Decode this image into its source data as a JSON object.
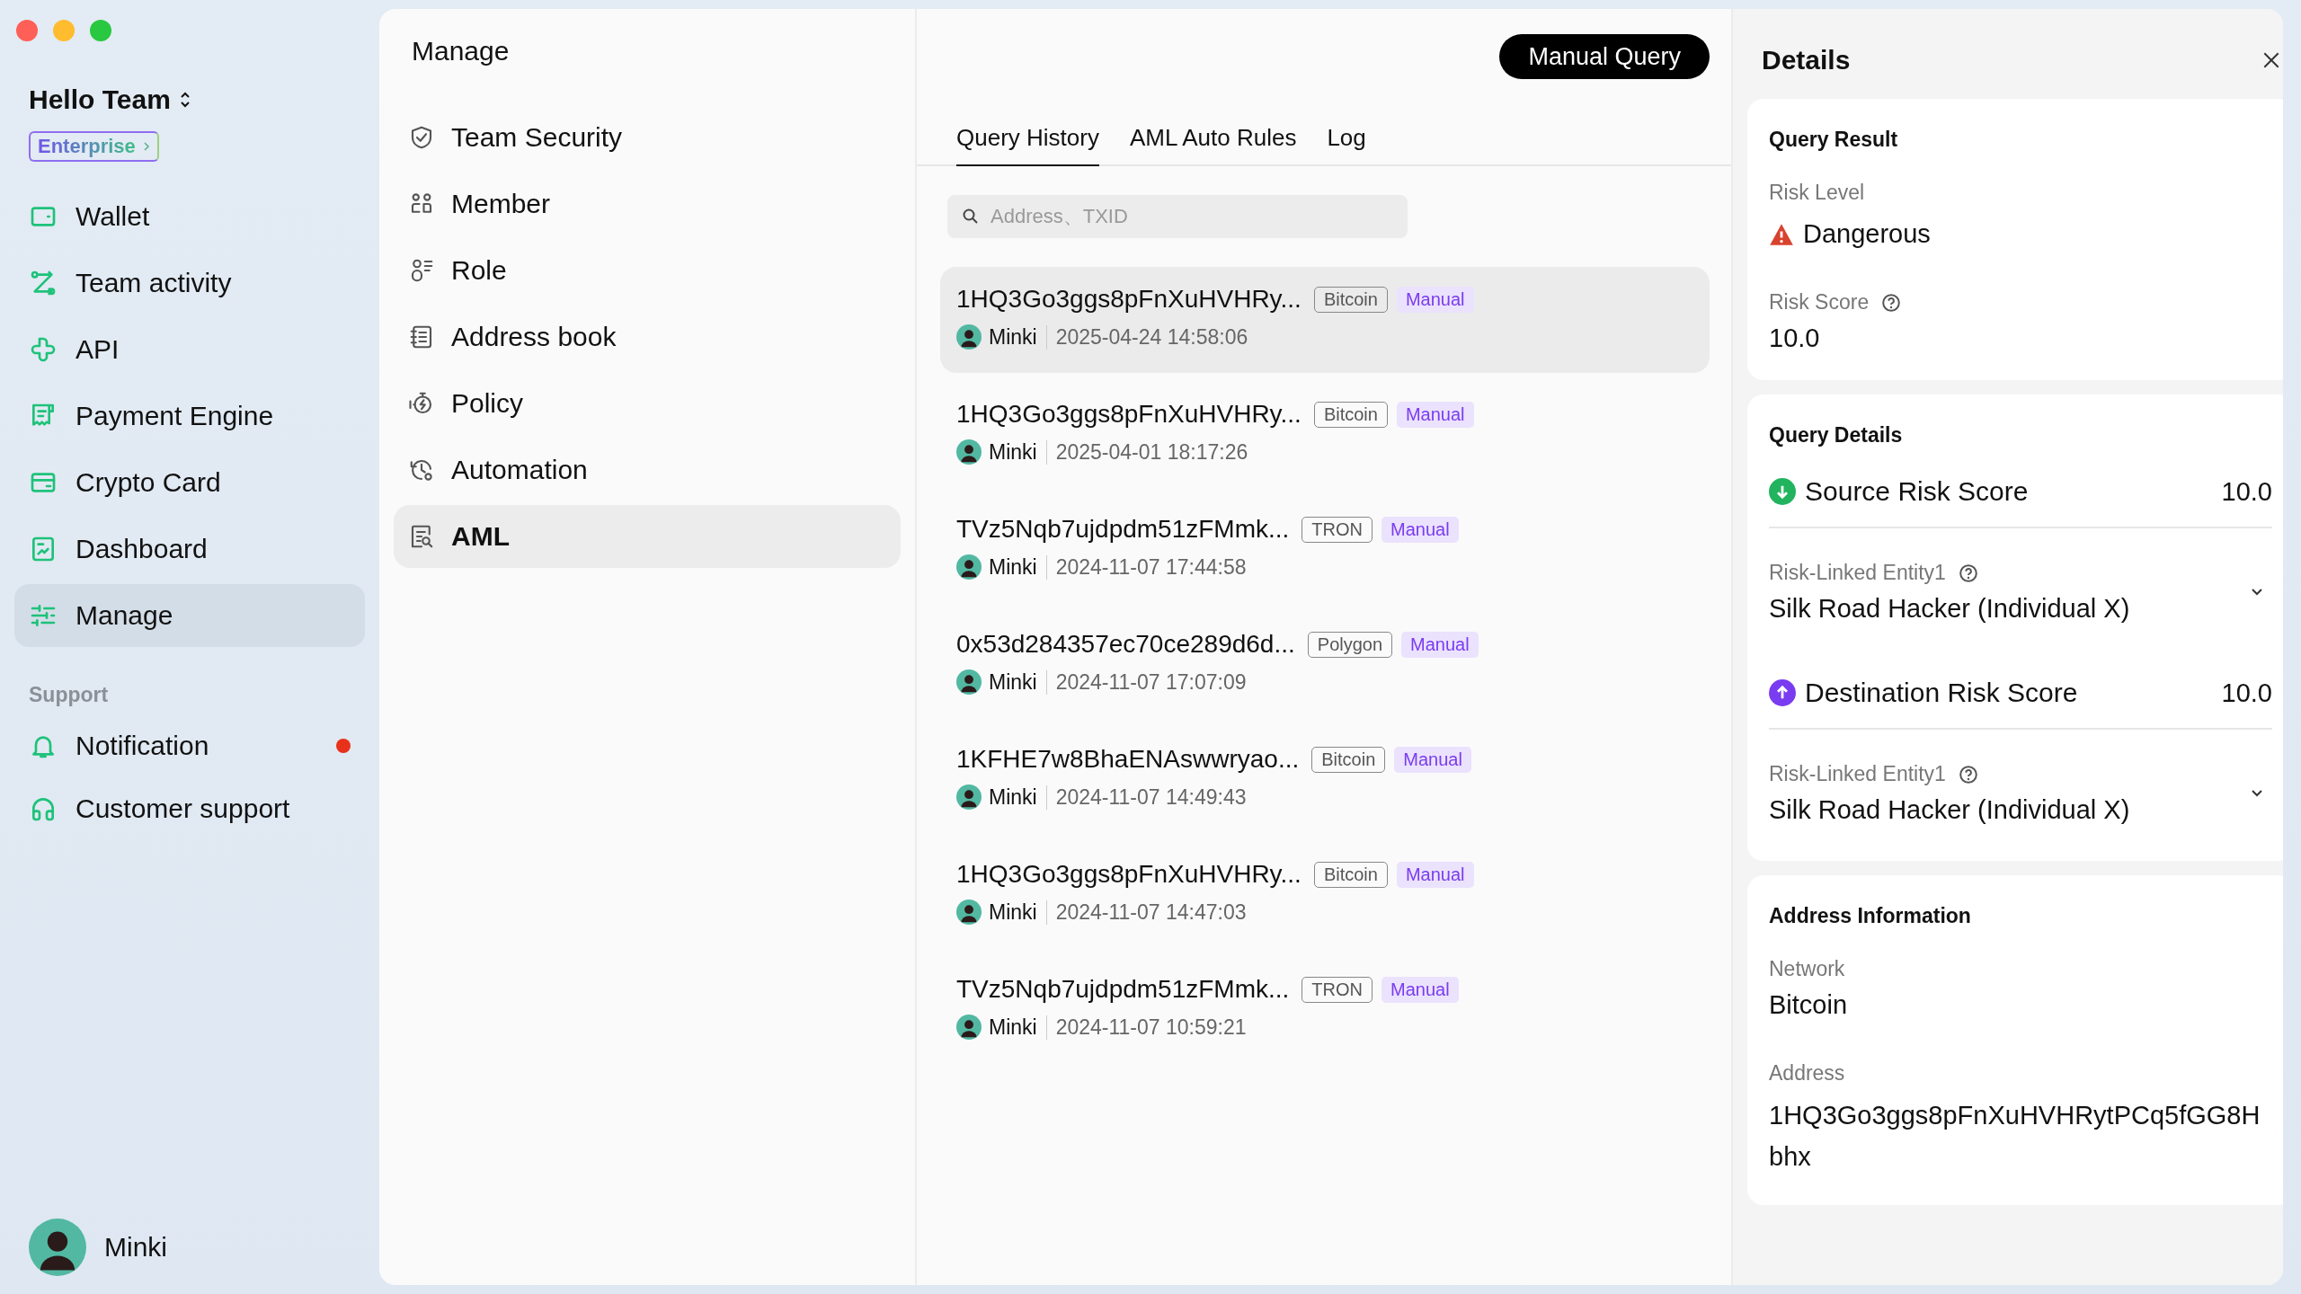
{
  "sidebar": {
    "team_name": "Hello Team",
    "plan_badge": "Enterprise",
    "nav": [
      {
        "label": "Wallet",
        "selected": false
      },
      {
        "label": "Team activity",
        "selected": false
      },
      {
        "label": "API",
        "selected": false
      },
      {
        "label": "Payment Engine",
        "selected": false
      },
      {
        "label": "Crypto Card",
        "selected": false
      },
      {
        "label": "Dashboard",
        "selected": false
      },
      {
        "label": "Manage",
        "selected": true
      }
    ],
    "support_label": "Support",
    "support": [
      {
        "label": "Notification",
        "unread": true
      },
      {
        "label": "Customer support",
        "unread": false
      }
    ],
    "user": {
      "name": "Minki"
    }
  },
  "manage_menu": {
    "title": "Manage",
    "items": [
      {
        "label": "Team Security",
        "selected": false
      },
      {
        "label": "Member",
        "selected": false
      },
      {
        "label": "Role",
        "selected": false
      },
      {
        "label": "Address book",
        "selected": false
      },
      {
        "label": "Policy",
        "selected": false
      },
      {
        "label": "Automation",
        "selected": false
      },
      {
        "label": "AML",
        "selected": true
      }
    ]
  },
  "query_panel": {
    "button": "Manual Query",
    "tabs": [
      {
        "label": "Query History",
        "selected": true
      },
      {
        "label": "AML Auto Rules",
        "selected": false
      },
      {
        "label": "Log",
        "selected": false
      }
    ],
    "search": {
      "placeholder": "Address、TXID"
    },
    "rows": [
      {
        "address": "1HQ3Go3ggs8pFnXuHVHRy...",
        "network": "Bitcoin",
        "source": "Manual",
        "user": "Minki",
        "time": "2025-04-24 14:58:06",
        "selected": true
      },
      {
        "address": "1HQ3Go3ggs8pFnXuHVHRy...",
        "network": "Bitcoin",
        "source": "Manual",
        "user": "Minki",
        "time": "2025-04-01 18:17:26",
        "selected": false
      },
      {
        "address": "TVz5Nqb7ujdpdm51zFMmk...",
        "network": "TRON",
        "source": "Manual",
        "user": "Minki",
        "time": "2024-11-07 17:44:58",
        "selected": false
      },
      {
        "address": "0x53d284357ec70ce289d6d...",
        "network": "Polygon",
        "source": "Manual",
        "user": "Minki",
        "time": "2024-11-07 17:07:09",
        "selected": false
      },
      {
        "address": "1KFHE7w8BhaENAswwryao...",
        "network": "Bitcoin",
        "source": "Manual",
        "user": "Minki",
        "time": "2024-11-07 14:49:43",
        "selected": false
      },
      {
        "address": "1HQ3Go3ggs8pFnXuHVHRy...",
        "network": "Bitcoin",
        "source": "Manual",
        "user": "Minki",
        "time": "2024-11-07 14:47:03",
        "selected": false
      },
      {
        "address": "TVz5Nqb7ujdpdm51zFMmk...",
        "network": "TRON",
        "source": "Manual",
        "user": "Minki",
        "time": "2024-11-07 10:59:21",
        "selected": false
      }
    ]
  },
  "details": {
    "title": "Details",
    "query_result": {
      "title": "Query Result",
      "risk_level_label": "Risk Level",
      "risk_level": "Dangerous",
      "risk_score_label": "Risk Score",
      "risk_score": "10.0"
    },
    "query_details": {
      "title": "Query Details",
      "sections": [
        {
          "kind": "source",
          "label": "Source Risk Score",
          "score": "10.0",
          "entity_label": "Risk-Linked Entity1",
          "entity": "Silk Road Hacker (Individual X)",
          "expanded": false
        },
        {
          "kind": "destination",
          "label": "Destination Risk Score",
          "score": "10.0",
          "entity_label": "Risk-Linked Entity1",
          "entity": "Silk Road Hacker (Individual X)",
          "expanded": false
        }
      ]
    },
    "address_info": {
      "title": "Address Information",
      "network_label": "Network",
      "network": "Bitcoin",
      "address_label": "Address",
      "address": "1HQ3Go3ggs8pFnXuHVHRytPCq5fGG8Hbhx"
    }
  }
}
